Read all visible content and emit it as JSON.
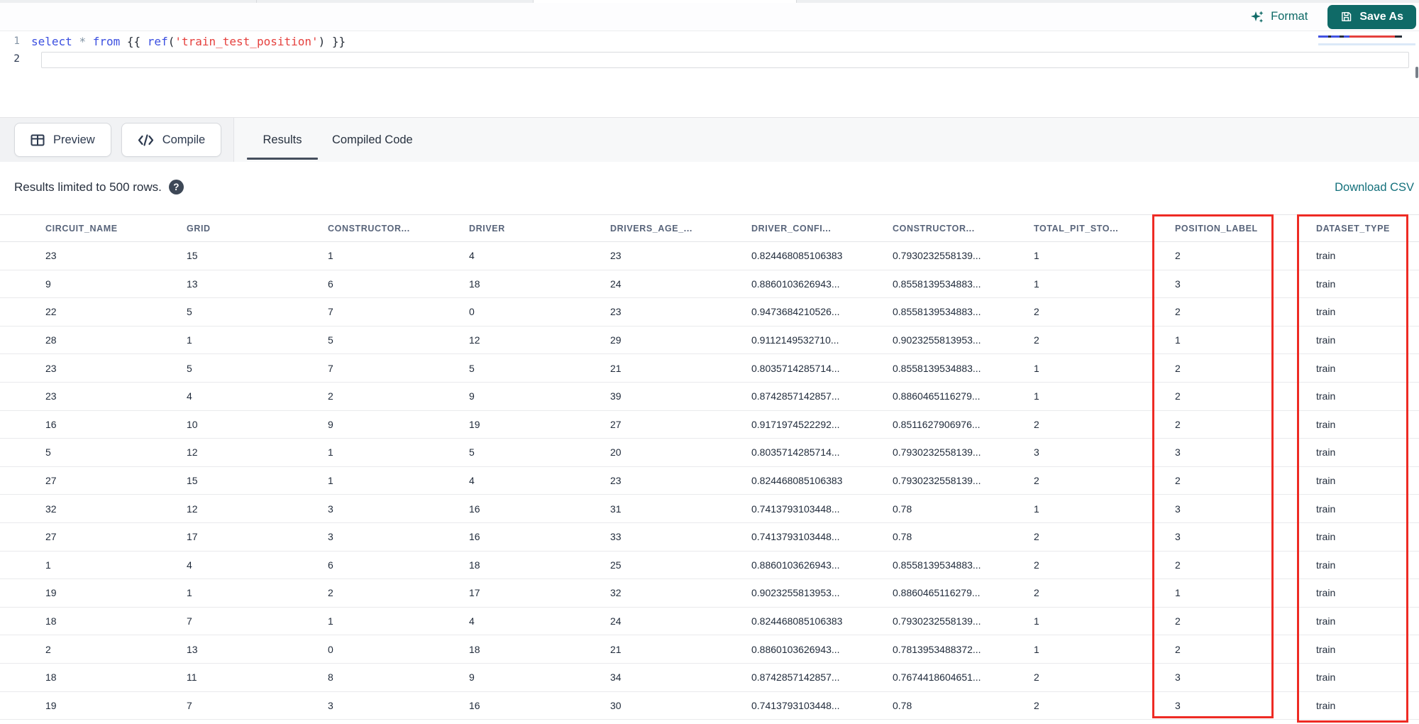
{
  "theme": {
    "accent_teal": "#0f6a67",
    "link_teal": "#13707b",
    "annotation_red": "#ee2b24",
    "tab_underline": "#454e5d",
    "code_keyword": "#3b4fe0",
    "code_string": "#e5413e",
    "code_punct": "#272e38",
    "code_operator": "#8193a4"
  },
  "icons": {
    "format": "sparkles-icon",
    "save_as": "floppy-disk-icon",
    "preview": "table-grid-icon",
    "compile": "code-brackets-icon",
    "help": "question-mark-circle-icon"
  },
  "header": {
    "format_label": "Format",
    "save_as_label": "Save As"
  },
  "editor": {
    "lines": [
      {
        "number": "1",
        "active": false,
        "tokens": [
          {
            "text": "select",
            "type": "keyword"
          },
          {
            "text": " ",
            "type": "plain"
          },
          {
            "text": "*",
            "type": "operator"
          },
          {
            "text": " ",
            "type": "plain"
          },
          {
            "text": "from",
            "type": "keyword"
          },
          {
            "text": " ",
            "type": "plain"
          },
          {
            "text": "{{ ",
            "type": "punct"
          },
          {
            "text": "ref",
            "type": "function"
          },
          {
            "text": "(",
            "type": "punct"
          },
          {
            "text": "'train_test_position'",
            "type": "string"
          },
          {
            "text": ")",
            "type": "punct"
          },
          {
            "text": " }}",
            "type": "punct"
          }
        ]
      },
      {
        "number": "2",
        "active": true,
        "tokens": []
      }
    ]
  },
  "toolbar": {
    "preview_label": "Preview",
    "compile_label": "Compile",
    "tabs": [
      {
        "label": "Results",
        "active": true
      },
      {
        "label": "Compiled Code",
        "active": false
      }
    ]
  },
  "results": {
    "limit_note": "Results limited to 500 rows.",
    "download_csv_label": "Download CSV"
  },
  "table": {
    "columns": [
      "CIRCUIT_NAME",
      "GRID",
      "CONSTRUCTOR...",
      "DRIVER",
      "DRIVERS_AGE_...",
      "DRIVER_CONFI...",
      "CONSTRUCTOR...",
      "TOTAL_PIT_STO...",
      "POSITION_LABEL",
      "DATASET_TYPE"
    ],
    "rows": [
      [
        "23",
        "15",
        "1",
        "4",
        "23",
        "0.824468085106383",
        "0.7930232558139...",
        "1",
        "2",
        "train"
      ],
      [
        "9",
        "13",
        "6",
        "18",
        "24",
        "0.8860103626943...",
        "0.8558139534883...",
        "1",
        "3",
        "train"
      ],
      [
        "22",
        "5",
        "7",
        "0",
        "23",
        "0.9473684210526...",
        "0.8558139534883...",
        "2",
        "2",
        "train"
      ],
      [
        "28",
        "1",
        "5",
        "12",
        "29",
        "0.9112149532710...",
        "0.9023255813953...",
        "2",
        "1",
        "train"
      ],
      [
        "23",
        "5",
        "7",
        "5",
        "21",
        "0.8035714285714...",
        "0.8558139534883...",
        "1",
        "2",
        "train"
      ],
      [
        "23",
        "4",
        "2",
        "9",
        "39",
        "0.8742857142857...",
        "0.8860465116279...",
        "1",
        "2",
        "train"
      ],
      [
        "16",
        "10",
        "9",
        "19",
        "27",
        "0.9171974522292...",
        "0.8511627906976...",
        "2",
        "2",
        "train"
      ],
      [
        "5",
        "12",
        "1",
        "5",
        "20",
        "0.8035714285714...",
        "0.7930232558139...",
        "3",
        "3",
        "train"
      ],
      [
        "27",
        "15",
        "1",
        "4",
        "23",
        "0.824468085106383",
        "0.7930232558139...",
        "2",
        "2",
        "train"
      ],
      [
        "32",
        "12",
        "3",
        "16",
        "31",
        "0.7413793103448...",
        "0.78",
        "1",
        "3",
        "train"
      ],
      [
        "27",
        "17",
        "3",
        "16",
        "33",
        "0.7413793103448...",
        "0.78",
        "2",
        "3",
        "train"
      ],
      [
        "1",
        "4",
        "6",
        "18",
        "25",
        "0.8860103626943...",
        "0.8558139534883...",
        "2",
        "2",
        "train"
      ],
      [
        "19",
        "1",
        "2",
        "17",
        "32",
        "0.9023255813953...",
        "0.8860465116279...",
        "2",
        "1",
        "train"
      ],
      [
        "18",
        "7",
        "1",
        "4",
        "24",
        "0.824468085106383",
        "0.7930232558139...",
        "1",
        "2",
        "train"
      ],
      [
        "2",
        "13",
        "0",
        "18",
        "21",
        "0.8860103626943...",
        "0.7813953488372...",
        "1",
        "2",
        "train"
      ],
      [
        "18",
        "11",
        "8",
        "9",
        "34",
        "0.8742857142857...",
        "0.7674418604651...",
        "2",
        "3",
        "train"
      ],
      [
        "19",
        "7",
        "3",
        "16",
        "30",
        "0.7413793103448...",
        "0.78",
        "2",
        "3",
        "train"
      ]
    ],
    "annotated_columns": [
      "POSITION_LABEL",
      "DATASET_TYPE"
    ]
  }
}
